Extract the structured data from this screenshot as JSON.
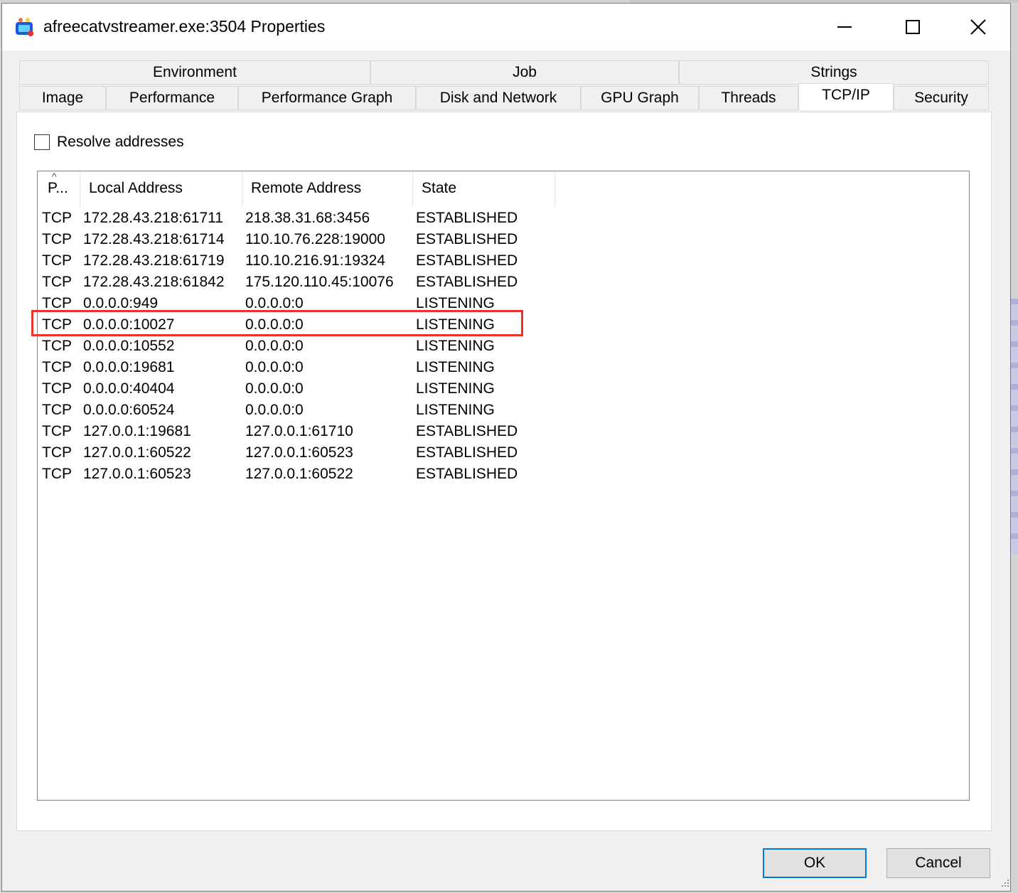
{
  "window": {
    "title": "afreecatvstreamer.exe:3504 Properties",
    "icon": "app-icon",
    "controls": {
      "minimize": "minimize-icon",
      "maximize": "maximize-icon",
      "close": "close-icon"
    }
  },
  "tabs": {
    "row1": [
      "Environment",
      "Job",
      "Strings"
    ],
    "row2": [
      "Image",
      "Performance",
      "Performance Graph",
      "Disk and Network",
      "GPU Graph",
      "Threads",
      "TCP/IP",
      "Security"
    ],
    "selected": "TCP/IP"
  },
  "resolve_checkbox": {
    "label": "Resolve addresses",
    "checked": false
  },
  "table": {
    "columns": [
      "P...",
      "Local Address",
      "Remote Address",
      "State"
    ],
    "rows": [
      [
        "TCP",
        "172.28.43.218:61711",
        "218.38.31.68:3456",
        "ESTABLISHED"
      ],
      [
        "TCP",
        "172.28.43.218:61714",
        "110.10.76.228:19000",
        "ESTABLISHED"
      ],
      [
        "TCP",
        "172.28.43.218:61719",
        "110.10.216.91:19324",
        "ESTABLISHED"
      ],
      [
        "TCP",
        "172.28.43.218:61842",
        "175.120.110.45:10076",
        "ESTABLISHED"
      ],
      [
        "TCP",
        "0.0.0.0:949",
        "0.0.0.0:0",
        "LISTENING"
      ],
      [
        "TCP",
        "0.0.0.0:10027",
        "0.0.0.0:0",
        "LISTENING"
      ],
      [
        "TCP",
        "0.0.0.0:10552",
        "0.0.0.0:0",
        "LISTENING"
      ],
      [
        "TCP",
        "0.0.0.0:19681",
        "0.0.0.0:0",
        "LISTENING"
      ],
      [
        "TCP",
        "0.0.0.0:40404",
        "0.0.0.0:0",
        "LISTENING"
      ],
      [
        "TCP",
        "0.0.0.0:60524",
        "0.0.0.0:0",
        "LISTENING"
      ],
      [
        "TCP",
        "127.0.0.1:19681",
        "127.0.0.1:61710",
        "ESTABLISHED"
      ],
      [
        "TCP",
        "127.0.0.1:60522",
        "127.0.0.1:60523",
        "ESTABLISHED"
      ],
      [
        "TCP",
        "127.0.0.1:60523",
        "127.0.0.1:60522",
        "ESTABLISHED"
      ]
    ],
    "highlighted_row": 5,
    "highlight_color": "#e8322a"
  },
  "buttons": {
    "ok": "OK",
    "cancel": "Cancel"
  }
}
